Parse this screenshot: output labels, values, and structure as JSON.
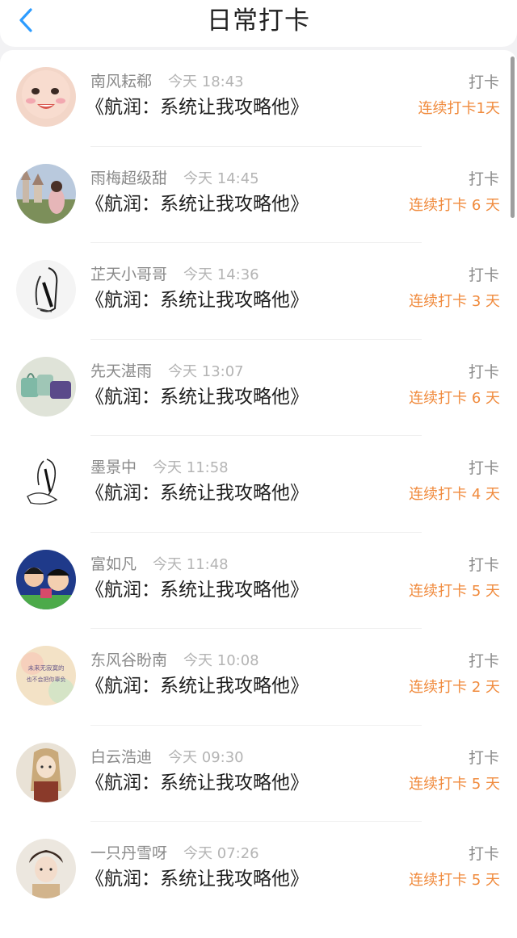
{
  "header": {
    "title": "日常打卡",
    "back_icon": "chevron-left-icon",
    "accent_color": "#2d9cff"
  },
  "checkins": [
    {
      "name": "南风耘郗",
      "time": "今天 18:43",
      "book": "《航润：系统让我攻略他》",
      "action": "打卡",
      "streak": "连续打卡1天",
      "avatar": "baby-face"
    },
    {
      "name": "雨梅超级甜",
      "time": "今天 14:45",
      "book": "《航润：系统让我攻略他》",
      "action": "打卡",
      "streak": "连续打卡 6 天",
      "avatar": "castle-girl"
    },
    {
      "name": "芷天小哥哥",
      "time": "今天 14:36",
      "book": "《航润：系统让我攻略他》",
      "action": "打卡",
      "streak": "连续打卡 3 天",
      "avatar": "sketch-figure"
    },
    {
      "name": "先天湛雨",
      "time": "今天 13:07",
      "book": "《航润：系统让我攻略他》",
      "action": "打卡",
      "streak": "连续打卡 6 天",
      "avatar": "handbags"
    },
    {
      "name": "墨景中",
      "time": "今天 11:58",
      "book": "《航润：系统让我攻略他》",
      "action": "打卡",
      "streak": "连续打卡 4 天",
      "avatar": "sketch-girl"
    },
    {
      "name": "富如凡",
      "time": "今天 11:48",
      "book": "《航润：系统让我攻略他》",
      "action": "打卡",
      "streak": "连续打卡 5 天",
      "avatar": "anime-group"
    },
    {
      "name": "东风谷盼南",
      "time": "今天 10:08",
      "book": "《航润：系统让我攻略他》",
      "action": "打卡",
      "streak": "连续打卡 2 天",
      "avatar": "calligraphy-text"
    },
    {
      "name": "白云浩迪",
      "time": "今天 09:30",
      "book": "《航润：系统让我攻略他》",
      "action": "打卡",
      "streak": "连续打卡 5 天",
      "avatar": "illustrated-girl"
    },
    {
      "name": "一只丹雪呀",
      "time": "今天 07:26",
      "book": "《航润：系统让我攻略他》",
      "action": "打卡",
      "streak": "连续打卡 5 天",
      "avatar": "anime-boy"
    }
  ],
  "colors": {
    "streak": "#f08a3c",
    "meta": "#8a8a8a",
    "time": "#b4b4b4",
    "book": "#1e1e1e"
  },
  "avatar_text": {
    "calligraphy": [
      "未来无寂寞的",
      "也不会把你辜负"
    ]
  }
}
